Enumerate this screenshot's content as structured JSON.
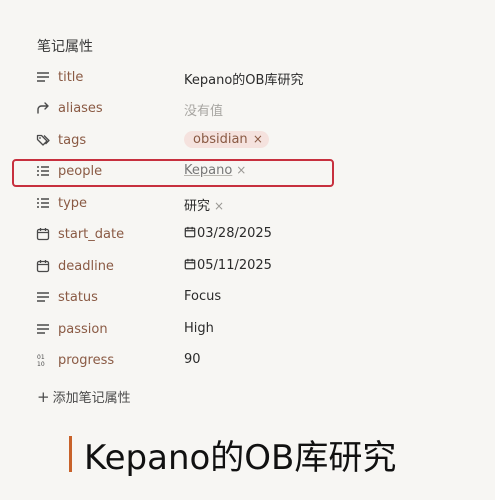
{
  "section_title": "笔记属性",
  "properties": [
    {
      "key": "title",
      "value": "Kepano的OB库研究",
      "icon": "list-icon"
    },
    {
      "key": "aliases",
      "placeholder": "没有值",
      "icon": "forward-arrow-icon"
    },
    {
      "key": "tags",
      "tag": "obsidian",
      "remove": "×",
      "icon": "tags-icon"
    },
    {
      "key": "people",
      "link": "Kepano",
      "remove": "×",
      "icon": "list-bullets-icon"
    },
    {
      "key": "type",
      "value": "研究",
      "remove": "×",
      "icon": "list-bullets-icon"
    },
    {
      "key": "start_date",
      "date": "03/28/2025",
      "icon": "calendar-icon"
    },
    {
      "key": "deadline",
      "date": "05/11/2025",
      "icon": "calendar-icon"
    },
    {
      "key": "status",
      "value": "Focus",
      "icon": "list-icon"
    },
    {
      "key": "passion",
      "value": "High",
      "icon": "list-icon"
    },
    {
      "key": "progress",
      "value": "90",
      "icon": "number-icon"
    }
  ],
  "add_property": {
    "plus": "+",
    "label": "添加笔记属性"
  },
  "caption": "Kepano的OB库研究",
  "colors": {
    "highlight": "#c7303e",
    "key_text": "#8a5a44",
    "tag_bg": "#f5e2de",
    "accent_bar": "#c8622a"
  }
}
